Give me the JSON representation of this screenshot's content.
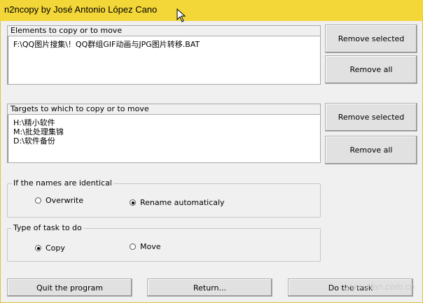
{
  "window": {
    "title": "n2ncopy by José Antonio López Cano"
  },
  "elements": {
    "header": "Elements to copy or to move",
    "items": [
      "F:\\QQ图片搜集\\！QQ群组GIF动画与JPG图片转移.BAT"
    ]
  },
  "targets": {
    "header": "Targets to which to copy or to move",
    "items": [
      "H:\\精小软件",
      "M:\\批处理集锦",
      "D:\\软件备份"
    ]
  },
  "buttons": {
    "remove_selected_top": "Remove selected",
    "remove_all_top": "Remove all",
    "remove_selected_bottom": "Remove selected",
    "remove_all_bottom": "Remove all",
    "quit": "Quit the program",
    "return": "Return...",
    "do_task": "Do the task"
  },
  "names_group": {
    "label": "If the names are identical",
    "options": [
      {
        "label": "Overwrite",
        "selected": false
      },
      {
        "label": "Rename automaticaly",
        "selected": true
      }
    ]
  },
  "task_group": {
    "label": "Type of task to do",
    "options": [
      {
        "label": "Copy",
        "selected": true
      },
      {
        "label": "Move",
        "selected": false
      }
    ]
  },
  "watermark": "www.cfan.com.cn",
  "colors": {
    "titlebar": "#f3d637",
    "window_bg": "#f0f0f0"
  }
}
